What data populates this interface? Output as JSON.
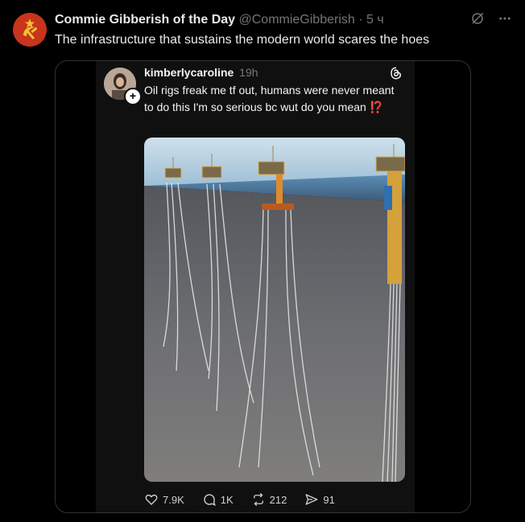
{
  "tweet": {
    "display_name": "Commie Gibberish of the Day",
    "handle": "@CommieGibberish",
    "separator": " · ",
    "time": "5 ч",
    "text": "The infrastructure that sustains the modern world scares the hoes",
    "avatar_color": "#c8341c"
  },
  "quoted_threads": {
    "username": "kimberlycaroline",
    "time": "19h",
    "text": "Oil rigs freak me tf out, humans were never meant to do this I'm so serious bc wut do you mean",
    "emoji": "⁉️",
    "actions": [
      {
        "icon": "heart-icon",
        "count": "7.9K"
      },
      {
        "icon": "comment-icon",
        "count": "1K"
      },
      {
        "icon": "repost-icon",
        "count": "212"
      },
      {
        "icon": "share-icon",
        "count": "91"
      }
    ]
  },
  "colors": {
    "background": "#000000",
    "text": "#e7e9ea",
    "muted": "#71767b",
    "card": "#101010",
    "accent_red": "#e0245e"
  }
}
